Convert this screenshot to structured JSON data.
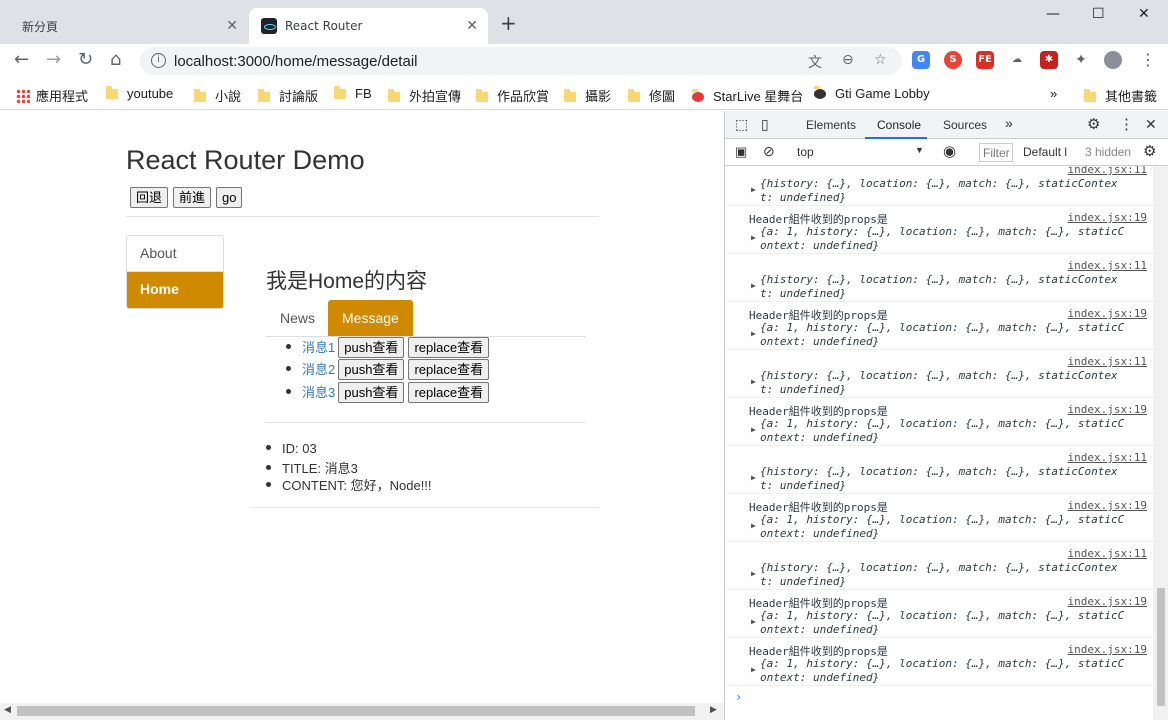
{
  "browser": {
    "tabs": [
      {
        "title": "新分頁"
      },
      {
        "title": "React Router"
      }
    ],
    "url": "localhost:3000/home/message/detail",
    "bookmarks": [
      "應用程式",
      "youtube",
      "小說",
      "討論版",
      "FB",
      "外拍宣傳",
      "作品欣賞",
      "攝影",
      "修圖",
      "StarLive 星舞台",
      "Gti Game Lobby"
    ],
    "other_bookmarks": "其他書籤"
  },
  "page": {
    "title": "React Router Demo",
    "history_buttons": [
      "回退",
      "前進",
      "go"
    ],
    "sidebar": [
      {
        "label": "About"
      },
      {
        "label": "Home"
      }
    ],
    "home_title": "我是Home的内容",
    "subtabs": [
      {
        "label": "News"
      },
      {
        "label": "Message"
      }
    ],
    "messages": [
      {
        "label": "消息1",
        "push": "push查看",
        "replace": "replace查看"
      },
      {
        "label": "消息2",
        "push": "push查看",
        "replace": "replace查看"
      },
      {
        "label": "消息3",
        "push": "push查看",
        "replace": "replace查看"
      }
    ],
    "detail": [
      "ID: 03",
      "TITLE: 消息3",
      "CONTENT: 您好，Node!!!"
    ]
  },
  "devtools": {
    "tabs": [
      "Elements",
      "Console",
      "Sources"
    ],
    "context": "top",
    "filter_placeholder": "Filter",
    "levels": "Default l",
    "hidden": "3 hidden",
    "messages": [
      {
        "source": "index.jsx:11",
        "label": "",
        "line1": "{history: {…}, location: {…}, match: {…}, staticContex",
        "line2": "t: undefined}"
      },
      {
        "source": "index.jsx:19",
        "label": "Header組件收到的props是",
        "line1": "{a: 1, history: {…}, location: {…}, match: {…}, staticC",
        "line2": "ontext: undefined}"
      },
      {
        "source": "index.jsx:11",
        "label": "",
        "line1": "{history: {…}, location: {…}, match: {…}, staticContex",
        "line2": "t: undefined}"
      },
      {
        "source": "index.jsx:19",
        "label": "Header組件收到的props是",
        "line1": "{a: 1, history: {…}, location: {…}, match: {…}, staticC",
        "line2": "ontext: undefined}"
      },
      {
        "source": "index.jsx:11",
        "label": "",
        "line1": "{history: {…}, location: {…}, match: {…}, staticContex",
        "line2": "t: undefined}"
      },
      {
        "source": "index.jsx:19",
        "label": "Header組件收到的props是",
        "line1": "{a: 1, history: {…}, location: {…}, match: {…}, staticC",
        "line2": "ontext: undefined}"
      },
      {
        "source": "index.jsx:11",
        "label": "",
        "line1": "{history: {…}, location: {…}, match: {…}, staticContex",
        "line2": "t: undefined}"
      },
      {
        "source": "index.jsx:19",
        "label": "Header組件收到的props是",
        "line1": "{a: 1, history: {…}, location: {…}, match: {…}, staticC",
        "line2": "ontext: undefined}"
      },
      {
        "source": "index.jsx:11",
        "label": "",
        "line1": "{history: {…}, location: {…}, match: {…}, staticContex",
        "line2": "t: undefined}"
      },
      {
        "source": "index.jsx:19",
        "label": "Header組件收到的props是",
        "line1": "{a: 1, history: {…}, location: {…}, match: {…}, staticC",
        "line2": "ontext: undefined}"
      },
      {
        "source": "index.jsx:19",
        "label": "Header組件收到的props是",
        "line1": "{a: 1, history: {…}, location: {…}, match: {…}, staticC",
        "line2": "ontext: undefined}"
      }
    ]
  },
  "colors": {
    "accent": "#d08a00",
    "link": "#337ab7",
    "devtools_active": "#1a73e8"
  }
}
